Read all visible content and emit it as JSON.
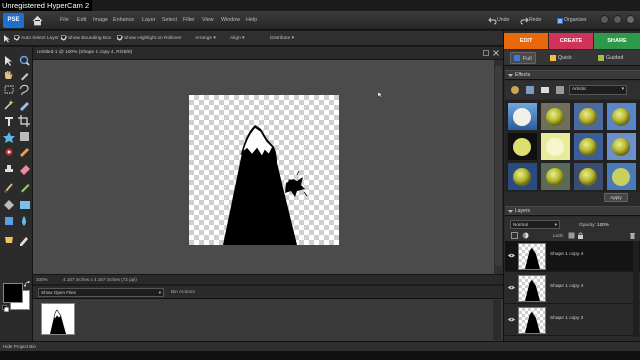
{
  "watermark": "Unregistered HyperCam 2",
  "app": {
    "logo_text": "PSE",
    "menu": [
      "File",
      "Edit",
      "Image",
      "Enhance",
      "Layer",
      "Select",
      "Filter",
      "View",
      "Window",
      "Help"
    ],
    "undo_label": "Undo",
    "redo_label": "Redo",
    "organizer_label": "Organizer"
  },
  "options_bar": {
    "auto_select": "Auto Select Layer",
    "bounding_box": "Show Bounding Box",
    "highlight": "Show Highlight on Rollover",
    "arrange": "Arrange",
    "align": "Align",
    "distribute": "Distribute"
  },
  "document": {
    "tab_title": "Untitled-1 @ 100% (Shape 1 copy 4, RGB/8)",
    "status_zoom": "100%",
    "status_size": "4.167 inches x 4.167 inches (72 ppi)"
  },
  "project_bin": {
    "select_label": "Show Open Files",
    "actions": "Bin Actions"
  },
  "bottom_bar": {
    "label": "Hide Project Bin"
  },
  "right_panel": {
    "mode_tabs": [
      {
        "label": "EDIT",
        "color": "#e8680a"
      },
      {
        "label": "CREATE",
        "color": "#d0325a"
      },
      {
        "label": "SHARE",
        "color": "#2d9a49"
      }
    ],
    "sub_tabs": [
      "Full",
      "Quick",
      "Guided"
    ],
    "effects": {
      "title": "Effects",
      "category": "Artistic",
      "apply_label": "Apply"
    },
    "layers": {
      "title": "Layers",
      "blend_mode": "Normal",
      "opacity_label": "Opacity:",
      "opacity_value": "100%",
      "lock_label": "Lock:",
      "items": [
        {
          "name": "Shape 1 copy 4",
          "selected": true
        },
        {
          "name": "Shape 1 copy 4",
          "selected": false
        },
        {
          "name": "Shape 1 copy 3",
          "selected": false
        }
      ]
    }
  },
  "colors": {
    "foreground": "#000000",
    "background": "#ffffff",
    "accent_blue": "#1f6fcf"
  }
}
